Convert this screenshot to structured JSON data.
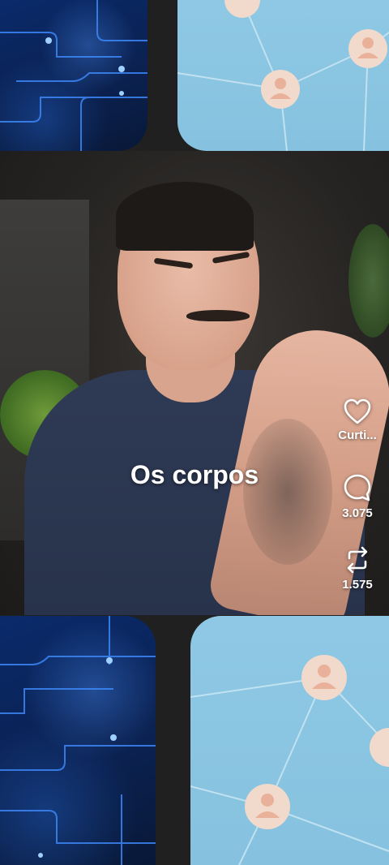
{
  "video": {
    "caption": "Os corpos"
  },
  "actions": {
    "like": {
      "icon": "heart-icon",
      "label": "Curti..."
    },
    "comment": {
      "icon": "comment-icon",
      "label": "3.075"
    },
    "repost": {
      "icon": "repost-icon",
      "label": "1.575"
    }
  },
  "colors": {
    "circuit_blue": "#0b2150",
    "network_blue": "#8ec8e4",
    "text": "#ffffff"
  }
}
